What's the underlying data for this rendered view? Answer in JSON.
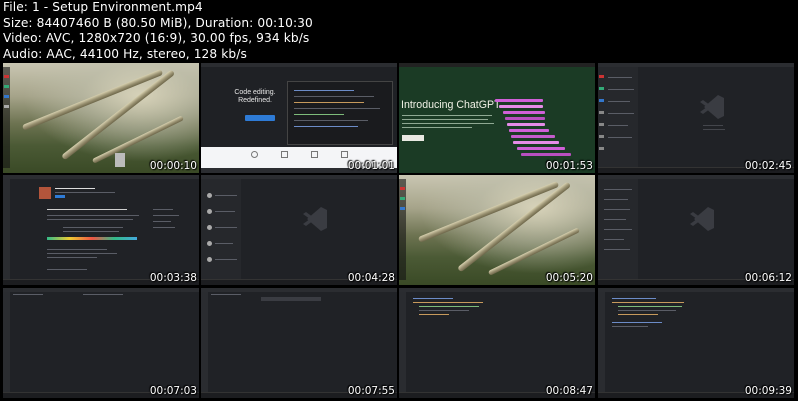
{
  "file_info": {
    "file": "File: 1 - Setup Environment.mp4",
    "size": "Size: 84407460 B (80.50 MiB), Duration: 00:10:30",
    "video": "Video: AVC, 1280x720 (16:9), 30.00 fps, 934 kb/s",
    "audio": "Audio: AAC, 44100 Hz, stereo, 128 kb/s"
  },
  "thumbnails": [
    {
      "timestamp": "00:00:10",
      "scene": "desktop-landscape"
    },
    {
      "timestamp": "00:01:01",
      "scene": "code-editing-website",
      "headline": "Code editing. Redefined."
    },
    {
      "timestamp": "00:01:53",
      "scene": "chatgpt-intro",
      "headline": "Introducing ChatGPT",
      "accent": "#d060d8"
    },
    {
      "timestamp": "00:02:45",
      "scene": "vscode-welcome"
    },
    {
      "timestamp": "00:03:38",
      "scene": "vscode-extension-page"
    },
    {
      "timestamp": "00:04:28",
      "scene": "vscode-welcome"
    },
    {
      "timestamp": "00:05:20",
      "scene": "desktop-landscape"
    },
    {
      "timestamp": "00:06:12",
      "scene": "vscode-welcome"
    },
    {
      "timestamp": "00:07:03",
      "scene": "vscode-empty-editor"
    },
    {
      "timestamp": "00:07:55",
      "scene": "vscode-empty-editor"
    },
    {
      "timestamp": "00:08:47",
      "scene": "vscode-code"
    },
    {
      "timestamp": "00:09:39",
      "scene": "vscode-code"
    }
  ],
  "colors": {
    "background": "#000000",
    "text": "#ffffff",
    "editor_bg": "#202226",
    "gpt_bg": "#1b3b25"
  }
}
